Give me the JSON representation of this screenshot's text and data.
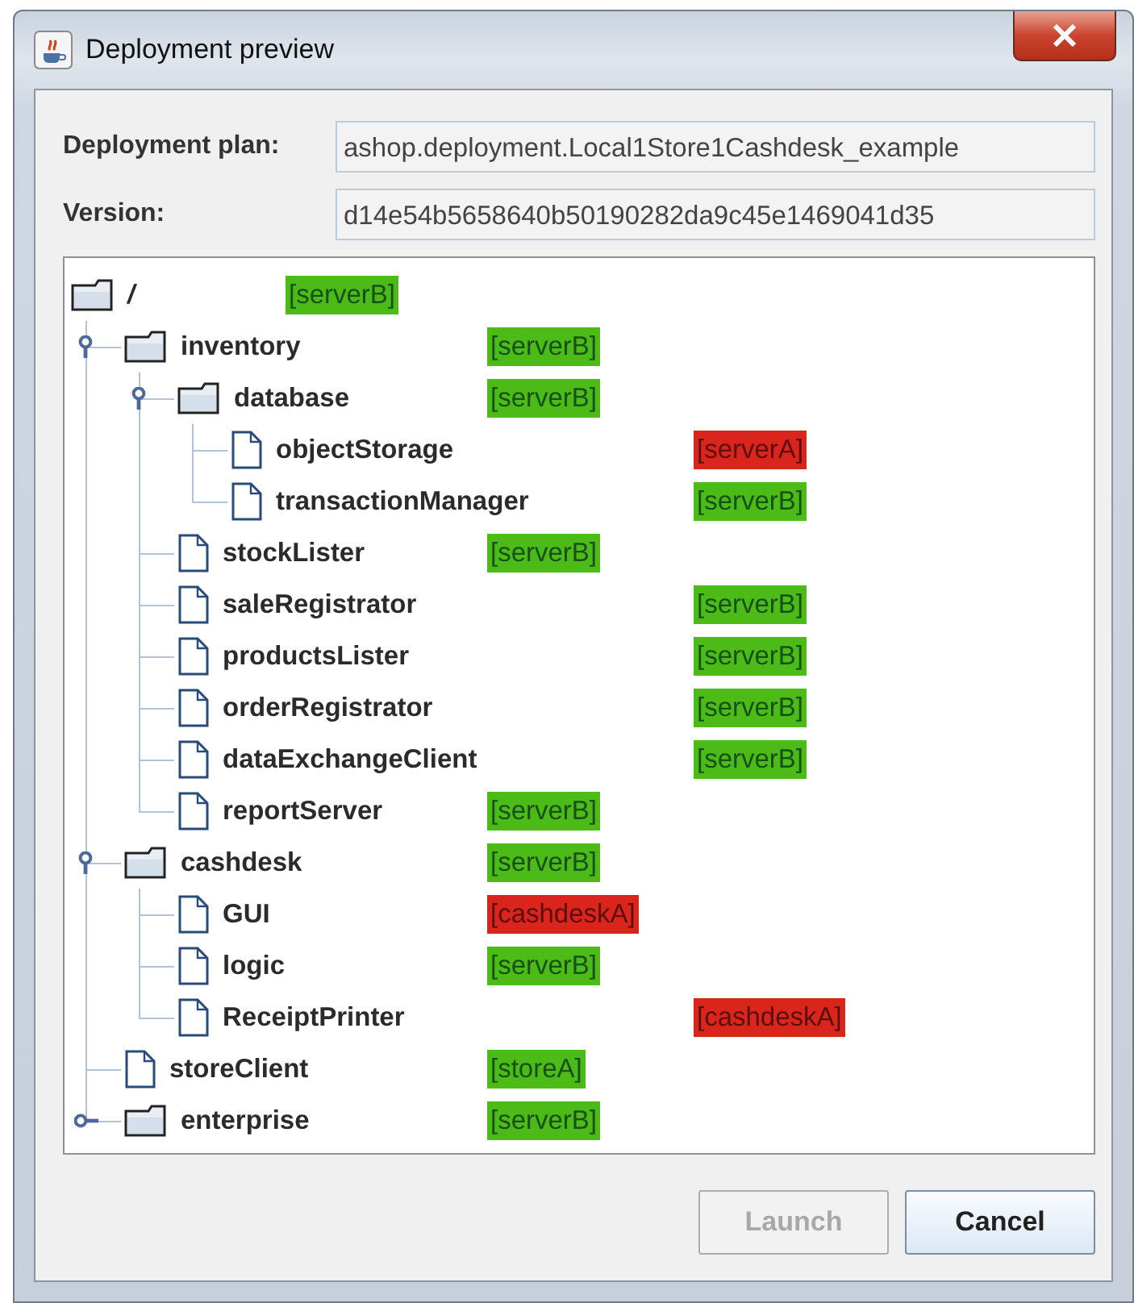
{
  "window": {
    "title": "Deployment preview"
  },
  "fields": [
    {
      "label": "Deployment plan:",
      "value": "ashop.deployment.Local1Store1Cashdesk_example"
    },
    {
      "label": "Version:",
      "value": "d14e54b5658640b50190282da9c45e1469041d35"
    }
  ],
  "tree": {
    "name": "/",
    "kind": "folder",
    "tag": "[serverB]",
    "color": "#4cbb17",
    "children": [
      {
        "name": "inventory",
        "kind": "folder",
        "expanded": true,
        "tag": "[serverB]",
        "color": "#4cbb17",
        "children": [
          {
            "name": "database",
            "kind": "folder",
            "expanded": true,
            "tag": "[serverB]",
            "color": "#4cbb17",
            "children": [
              {
                "name": "objectStorage",
                "kind": "file",
                "tag": "[serverA]",
                "color": "#d9251c"
              },
              {
                "name": "transactionManager",
                "kind": "file",
                "tag": "[serverB]",
                "color": "#4cbb17"
              }
            ]
          },
          {
            "name": "stockLister",
            "kind": "file",
            "tag": "[serverB]",
            "color": "#4cbb17"
          },
          {
            "name": "saleRegistrator",
            "kind": "file",
            "tag": "[serverB]",
            "color": "#4cbb17"
          },
          {
            "name": "productsLister",
            "kind": "file",
            "tag": "[serverB]",
            "color": "#4cbb17"
          },
          {
            "name": "orderRegistrator",
            "kind": "file",
            "tag": "[serverB]",
            "color": "#4cbb17"
          },
          {
            "name": "dataExchangeClient",
            "kind": "file",
            "tag": "[serverB]",
            "color": "#4cbb17"
          },
          {
            "name": "reportServer",
            "kind": "file",
            "tag": "[serverB]",
            "color": "#4cbb17"
          }
        ]
      },
      {
        "name": "cashdesk",
        "kind": "folder",
        "expanded": true,
        "tag": "[serverB]",
        "color": "#4cbb17",
        "children": [
          {
            "name": "GUI",
            "kind": "file",
            "tag": "[cashdeskA]",
            "color": "#d9251c"
          },
          {
            "name": "logic",
            "kind": "file",
            "tag": "[serverB]",
            "color": "#4cbb17"
          },
          {
            "name": "ReceiptPrinter",
            "kind": "file",
            "tag": "[cashdeskA]",
            "color": "#d9251c"
          }
        ]
      },
      {
        "name": "storeClient",
        "kind": "file",
        "tag": "[storeA]",
        "color": "#4cbb17"
      },
      {
        "name": "enterprise",
        "kind": "folder",
        "expanded": false,
        "tag": "[serverB]",
        "color": "#4cbb17"
      }
    ]
  },
  "buttons": [
    {
      "label": "Launch",
      "disabled": true
    },
    {
      "label": "Cancel",
      "disabled": false
    }
  ]
}
